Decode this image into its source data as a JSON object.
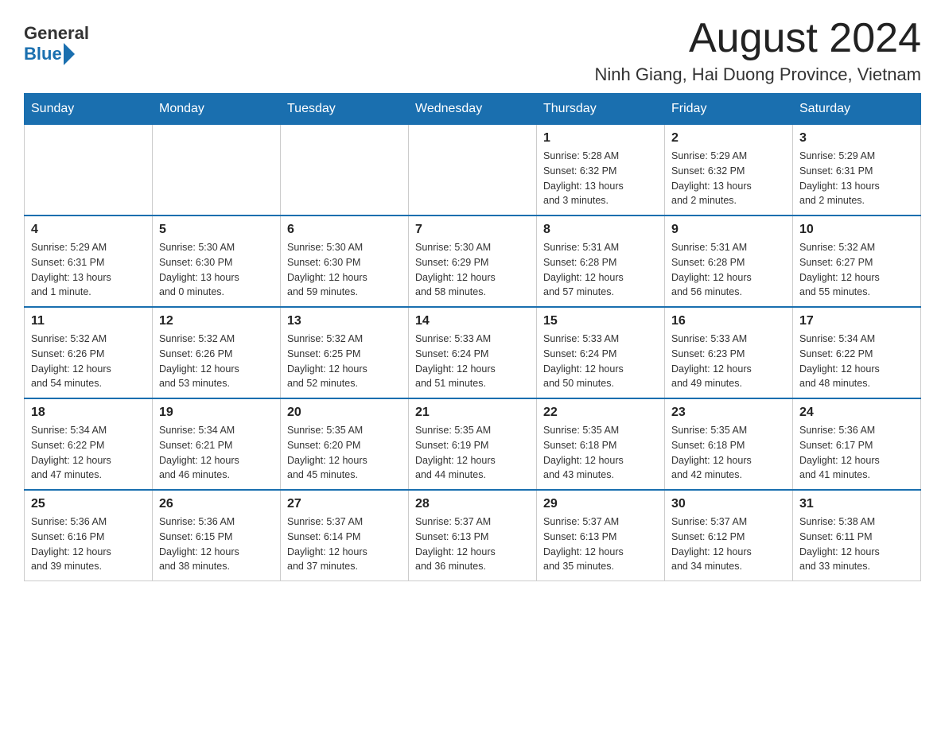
{
  "header": {
    "logo_general": "General",
    "logo_blue": "Blue",
    "month_title": "August 2024",
    "location": "Ninh Giang, Hai Duong Province, Vietnam"
  },
  "weekdays": [
    "Sunday",
    "Monday",
    "Tuesday",
    "Wednesday",
    "Thursday",
    "Friday",
    "Saturday"
  ],
  "weeks": [
    [
      {
        "day": "",
        "info": ""
      },
      {
        "day": "",
        "info": ""
      },
      {
        "day": "",
        "info": ""
      },
      {
        "day": "",
        "info": ""
      },
      {
        "day": "1",
        "info": "Sunrise: 5:28 AM\nSunset: 6:32 PM\nDaylight: 13 hours\nand 3 minutes."
      },
      {
        "day": "2",
        "info": "Sunrise: 5:29 AM\nSunset: 6:32 PM\nDaylight: 13 hours\nand 2 minutes."
      },
      {
        "day": "3",
        "info": "Sunrise: 5:29 AM\nSunset: 6:31 PM\nDaylight: 13 hours\nand 2 minutes."
      }
    ],
    [
      {
        "day": "4",
        "info": "Sunrise: 5:29 AM\nSunset: 6:31 PM\nDaylight: 13 hours\nand 1 minute."
      },
      {
        "day": "5",
        "info": "Sunrise: 5:30 AM\nSunset: 6:30 PM\nDaylight: 13 hours\nand 0 minutes."
      },
      {
        "day": "6",
        "info": "Sunrise: 5:30 AM\nSunset: 6:30 PM\nDaylight: 12 hours\nand 59 minutes."
      },
      {
        "day": "7",
        "info": "Sunrise: 5:30 AM\nSunset: 6:29 PM\nDaylight: 12 hours\nand 58 minutes."
      },
      {
        "day": "8",
        "info": "Sunrise: 5:31 AM\nSunset: 6:28 PM\nDaylight: 12 hours\nand 57 minutes."
      },
      {
        "day": "9",
        "info": "Sunrise: 5:31 AM\nSunset: 6:28 PM\nDaylight: 12 hours\nand 56 minutes."
      },
      {
        "day": "10",
        "info": "Sunrise: 5:32 AM\nSunset: 6:27 PM\nDaylight: 12 hours\nand 55 minutes."
      }
    ],
    [
      {
        "day": "11",
        "info": "Sunrise: 5:32 AM\nSunset: 6:26 PM\nDaylight: 12 hours\nand 54 minutes."
      },
      {
        "day": "12",
        "info": "Sunrise: 5:32 AM\nSunset: 6:26 PM\nDaylight: 12 hours\nand 53 minutes."
      },
      {
        "day": "13",
        "info": "Sunrise: 5:32 AM\nSunset: 6:25 PM\nDaylight: 12 hours\nand 52 minutes."
      },
      {
        "day": "14",
        "info": "Sunrise: 5:33 AM\nSunset: 6:24 PM\nDaylight: 12 hours\nand 51 minutes."
      },
      {
        "day": "15",
        "info": "Sunrise: 5:33 AM\nSunset: 6:24 PM\nDaylight: 12 hours\nand 50 minutes."
      },
      {
        "day": "16",
        "info": "Sunrise: 5:33 AM\nSunset: 6:23 PM\nDaylight: 12 hours\nand 49 minutes."
      },
      {
        "day": "17",
        "info": "Sunrise: 5:34 AM\nSunset: 6:22 PM\nDaylight: 12 hours\nand 48 minutes."
      }
    ],
    [
      {
        "day": "18",
        "info": "Sunrise: 5:34 AM\nSunset: 6:22 PM\nDaylight: 12 hours\nand 47 minutes."
      },
      {
        "day": "19",
        "info": "Sunrise: 5:34 AM\nSunset: 6:21 PM\nDaylight: 12 hours\nand 46 minutes."
      },
      {
        "day": "20",
        "info": "Sunrise: 5:35 AM\nSunset: 6:20 PM\nDaylight: 12 hours\nand 45 minutes."
      },
      {
        "day": "21",
        "info": "Sunrise: 5:35 AM\nSunset: 6:19 PM\nDaylight: 12 hours\nand 44 minutes."
      },
      {
        "day": "22",
        "info": "Sunrise: 5:35 AM\nSunset: 6:18 PM\nDaylight: 12 hours\nand 43 minutes."
      },
      {
        "day": "23",
        "info": "Sunrise: 5:35 AM\nSunset: 6:18 PM\nDaylight: 12 hours\nand 42 minutes."
      },
      {
        "day": "24",
        "info": "Sunrise: 5:36 AM\nSunset: 6:17 PM\nDaylight: 12 hours\nand 41 minutes."
      }
    ],
    [
      {
        "day": "25",
        "info": "Sunrise: 5:36 AM\nSunset: 6:16 PM\nDaylight: 12 hours\nand 39 minutes."
      },
      {
        "day": "26",
        "info": "Sunrise: 5:36 AM\nSunset: 6:15 PM\nDaylight: 12 hours\nand 38 minutes."
      },
      {
        "day": "27",
        "info": "Sunrise: 5:37 AM\nSunset: 6:14 PM\nDaylight: 12 hours\nand 37 minutes."
      },
      {
        "day": "28",
        "info": "Sunrise: 5:37 AM\nSunset: 6:13 PM\nDaylight: 12 hours\nand 36 minutes."
      },
      {
        "day": "29",
        "info": "Sunrise: 5:37 AM\nSunset: 6:13 PM\nDaylight: 12 hours\nand 35 minutes."
      },
      {
        "day": "30",
        "info": "Sunrise: 5:37 AM\nSunset: 6:12 PM\nDaylight: 12 hours\nand 34 minutes."
      },
      {
        "day": "31",
        "info": "Sunrise: 5:38 AM\nSunset: 6:11 PM\nDaylight: 12 hours\nand 33 minutes."
      }
    ]
  ]
}
